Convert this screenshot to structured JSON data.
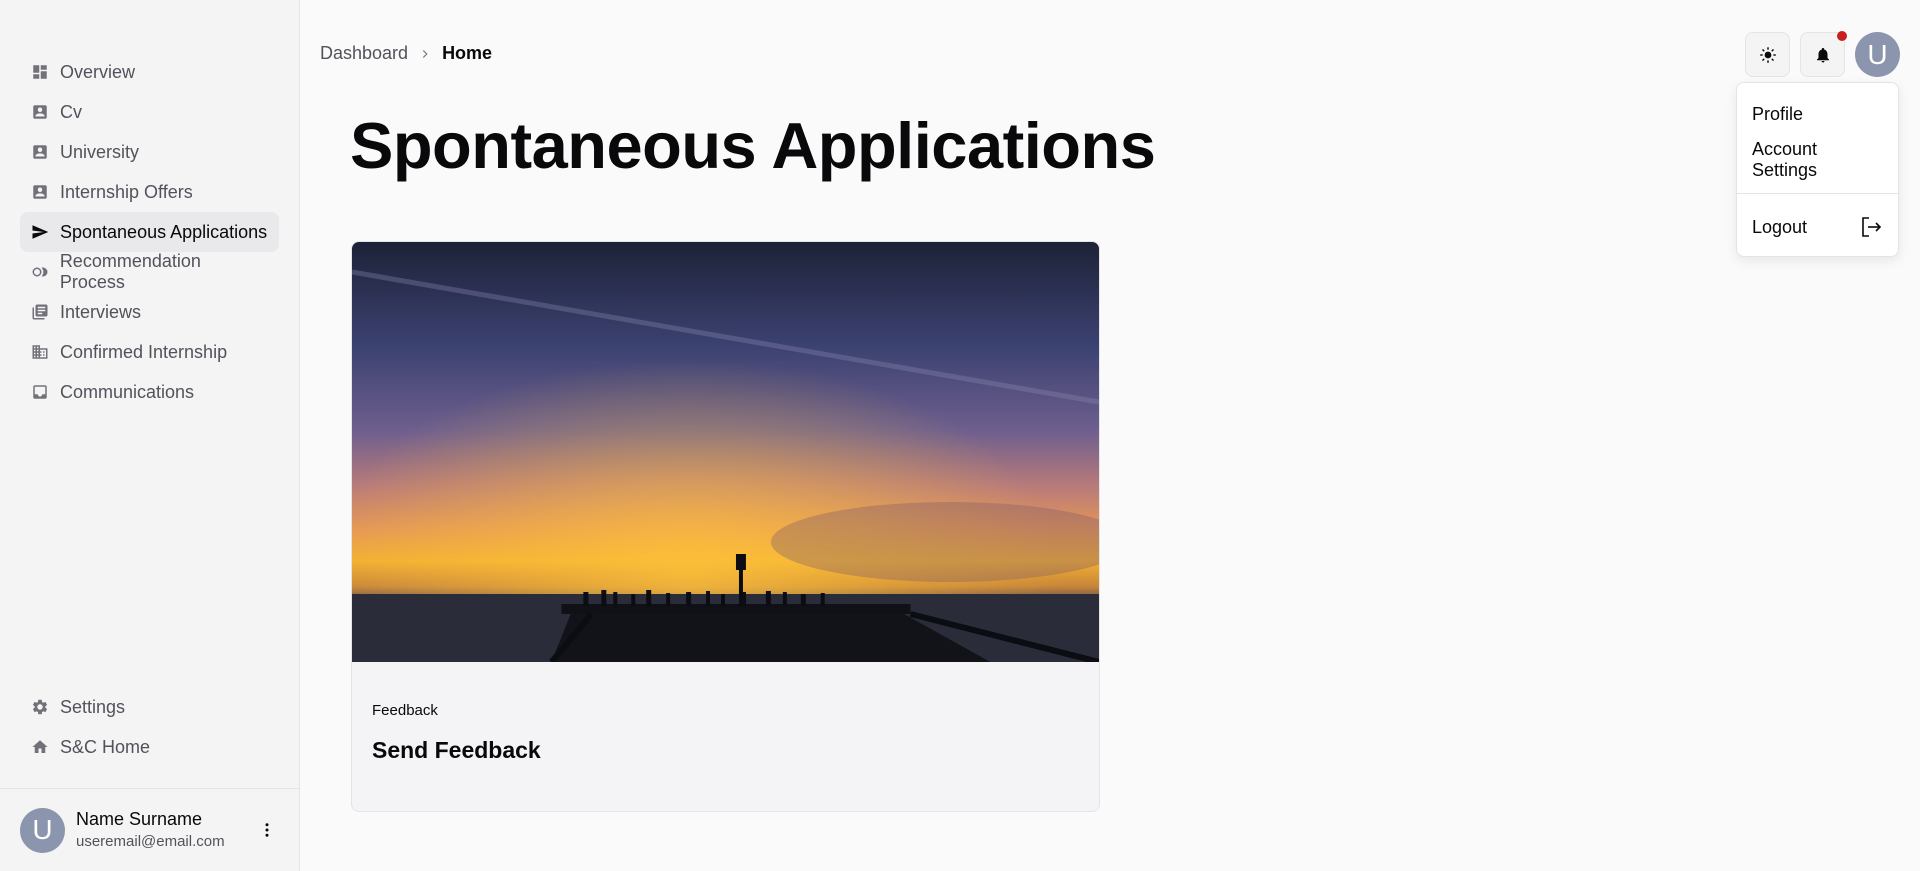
{
  "sidebar": {
    "items": [
      {
        "label": "Overview",
        "icon": "dashboard-icon"
      },
      {
        "label": "Cv",
        "icon": "contact-card-icon"
      },
      {
        "label": "University",
        "icon": "contact-card-icon"
      },
      {
        "label": "Internship Offers",
        "icon": "contact-card-icon"
      },
      {
        "label": "Spontaneous Applications",
        "icon": "send-icon",
        "active": true
      },
      {
        "label": "Recommendation Process",
        "icon": "toggle-circles-icon"
      },
      {
        "label": "Interviews",
        "icon": "library-icon"
      },
      {
        "label": "Confirmed Internship",
        "icon": "building-icon"
      },
      {
        "label": "Communications",
        "icon": "inbox-icon"
      }
    ],
    "bottom_items": [
      {
        "label": "Settings",
        "icon": "gear-icon"
      },
      {
        "label": "S&C Home",
        "icon": "home-icon"
      }
    ],
    "user": {
      "initial": "U",
      "name": "Name Surname",
      "email": "useremail@email.com"
    }
  },
  "header": {
    "breadcrumb": {
      "parent": "Dashboard",
      "current": "Home"
    },
    "avatar_initial": "U",
    "notification_dot_color": "#c81e1e"
  },
  "main": {
    "title": "Spontaneous Applications",
    "card": {
      "category": "Feedback",
      "title": "Send Feedback"
    }
  },
  "dropdown": {
    "items": [
      "Profile",
      "Account Settings"
    ],
    "logout": "Logout"
  },
  "colors": {
    "avatar": "#8b95ad",
    "sidebar_bg": "#f4f4f5",
    "active_item_bg": "#e9e9ec"
  }
}
